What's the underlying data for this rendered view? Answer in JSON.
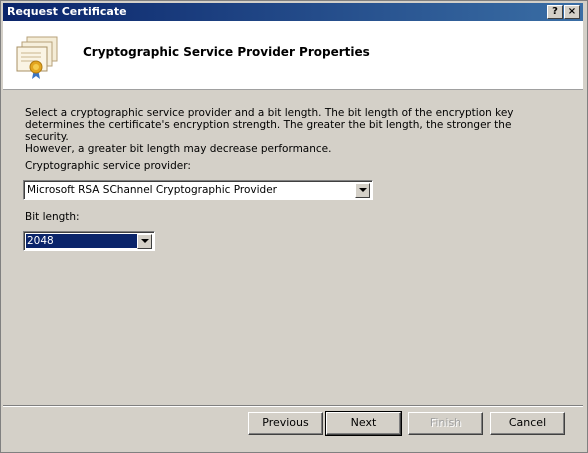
{
  "window": {
    "title": "Request Certificate",
    "help_glyph": "?",
    "close_glyph": "×"
  },
  "header": {
    "title": "Cryptographic Service Provider Properties",
    "icon": "certificate-icon"
  },
  "body": {
    "intro_line1": "Select a cryptographic service provider and a bit length. The bit length of the encryption key",
    "intro_line2": "determines the certificate's encryption strength. The greater the bit length, the stronger the security.",
    "intro_line3": "However, a greater bit length may decrease performance.",
    "csp_label": "Cryptographic service provider:",
    "csp_value": "Microsoft RSA SChannel Cryptographic Provider",
    "bit_label": "Bit length:",
    "bit_value": "2048"
  },
  "buttons": {
    "previous": "Previous",
    "next": "Next",
    "finish": "Finish",
    "cancel": "Cancel"
  },
  "colors": {
    "titlebar": "#0a246a",
    "dialog_bg": "#d4d0c8",
    "selection": "#0a246a"
  }
}
